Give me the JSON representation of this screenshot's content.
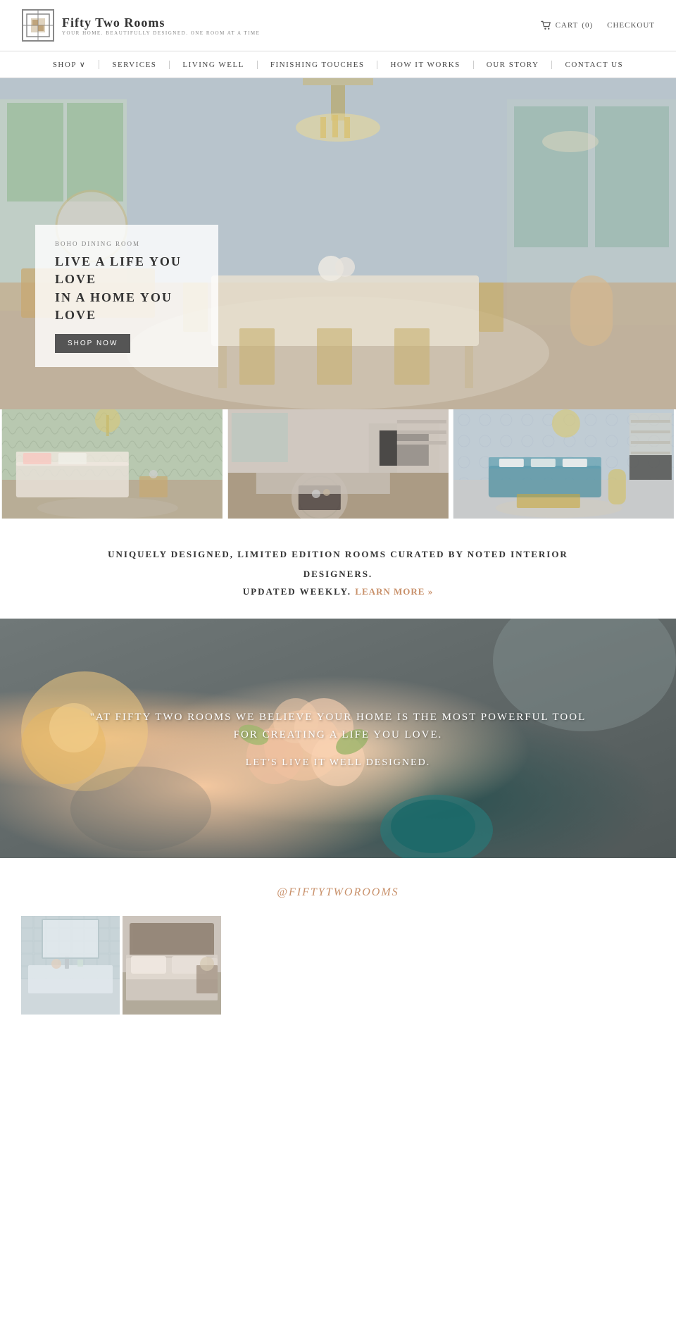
{
  "header": {
    "logo_title": "Fifty Two Rooms",
    "logo_subtitle": "YOUR HOME. BEAUTIFULLY DESIGNED. ONE ROOM AT A TIME",
    "cart_label": "CART",
    "cart_count": "(0)",
    "checkout_label": "CHECKOUT"
  },
  "nav": {
    "items": [
      {
        "label": "SHOP ∨",
        "id": "shop"
      },
      {
        "label": "SERVICES",
        "id": "services"
      },
      {
        "label": "LIVING WELL",
        "id": "living-well"
      },
      {
        "label": "FINISHING TOUCHES",
        "id": "finishing-touches"
      },
      {
        "label": "HOW IT WORKS",
        "id": "how-it-works"
      },
      {
        "label": "OUR STORY",
        "id": "our-story"
      },
      {
        "label": "CONTACT US",
        "id": "contact-us"
      }
    ]
  },
  "hero": {
    "room_label": "BOHO DINING ROOM",
    "tagline_line1": "LIVE A LIFE YOU LOVE",
    "tagline_line2": "IN A HOME YOU LOVE",
    "shop_button": "SHOP NOW"
  },
  "tagline_section": {
    "line1": "UNIQUELY DESIGNED, LIMITED EDITION ROOMS CURATED BY NOTED INTERIOR",
    "line2": "DESIGNERS.",
    "line3": "UPDATED WEEKLY.",
    "learn_more": "LEARN MORE »"
  },
  "banner": {
    "quote_line1": "\"AT FIFTY TWO ROOMS WE BELIEVE YOUR HOME IS THE MOST POWERFUL TOOL",
    "quote_line2": "FOR CREATING A LIFE YOU LOVE.",
    "sub_line": "LET'S LIVE IT WELL DESIGNED."
  },
  "instagram": {
    "handle": "@FIFTYTWOROOMS",
    "thumbs": [
      {
        "id": "bathroom",
        "alt": "Bathroom"
      },
      {
        "id": "bedroom",
        "alt": "Bedroom"
      }
    ]
  }
}
